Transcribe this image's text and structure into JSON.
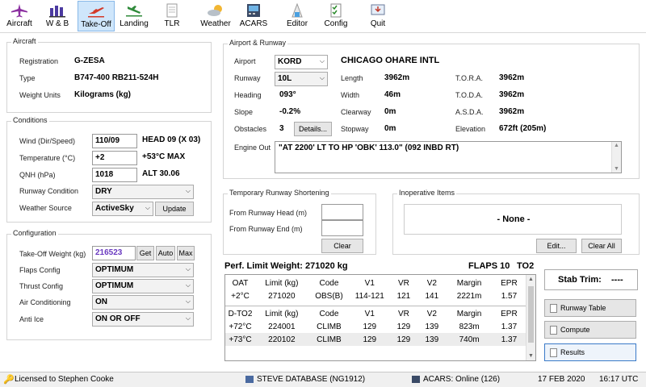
{
  "toolbar": {
    "items": [
      {
        "label": "Aircraft",
        "icon": "aircraft-icon"
      },
      {
        "label": "W & B",
        "icon": "weight-balance-icon"
      },
      {
        "label": "Take-Off",
        "icon": "takeoff-icon"
      },
      {
        "label": "Landing",
        "icon": "landing-icon"
      },
      {
        "label": "TLR",
        "icon": "tlr-document-icon"
      },
      {
        "label": "Weather",
        "icon": "weather-icon"
      },
      {
        "label": "ACARS",
        "icon": "acars-icon"
      },
      {
        "label": "Editor",
        "icon": "editor-icon"
      },
      {
        "label": "Config",
        "icon": "config-icon"
      },
      {
        "label": "Quit",
        "icon": "quit-icon"
      }
    ],
    "active": "Take-Off"
  },
  "aircraft": {
    "title": "Aircraft",
    "registration_label": "Registration",
    "registration": "G-ZESA",
    "type_label": "Type",
    "type": "B747-400 RB211-524H",
    "weight_units_label": "Weight Units",
    "weight_units": "Kilograms (kg)"
  },
  "conditions": {
    "title": "Conditions",
    "wind_label": "Wind (Dir/Speed)",
    "wind": "110/09",
    "wind_info": "HEAD 09 (X 03)",
    "temp_label": "Temperature (°C)",
    "temp": "+2",
    "temp_info": "+53°C MAX",
    "qnh_label": "QNH (hPa)",
    "qnh": "1018",
    "qnh_info": "ALT 30.06",
    "rwy_cond_label": "Runway Condition",
    "rwy_cond": "DRY",
    "wx_source_label": "Weather Source",
    "wx_source": "ActiveSky",
    "update_button": "Update"
  },
  "configuration": {
    "title": "Configuration",
    "tow_label": "Take-Off Weight (kg)",
    "tow": "216523",
    "get_button": "Get",
    "auto_button": "Auto",
    "max_button": "Max",
    "flaps_label": "Flaps Config",
    "flaps": "OPTIMUM",
    "thrust_label": "Thrust Config",
    "thrust": "OPTIMUM",
    "aircon_label": "Air Conditioning",
    "aircon": "ON",
    "antiice_label": "Anti Ice",
    "antiice": "ON OR OFF"
  },
  "airport": {
    "title": "Airport & Runway",
    "airport_label": "Airport",
    "airport": "KORD",
    "airport_name": "CHICAGO OHARE INTL",
    "runway_label": "Runway",
    "runway": "10L",
    "heading_label": "Heading",
    "heading": "093°",
    "slope_label": "Slope",
    "slope": "-0.2%",
    "obstacles_label": "Obstacles",
    "obstacles": "3",
    "details_button": "Details...",
    "length_label": "Length",
    "length": "3962m",
    "width_label": "Width",
    "width": "46m",
    "clearway_label": "Clearway",
    "clearway": "0m",
    "stopway_label": "Stopway",
    "stopway": "0m",
    "tora_label": "T.O.R.A.",
    "tora": "3962m",
    "toda_label": "T.O.D.A.",
    "toda": "3962m",
    "asda_label": "A.S.D.A.",
    "asda": "3962m",
    "elevation_label": "Elevation",
    "elevation": "672ft (205m)",
    "engine_out_label": "Engine Out",
    "engine_out": "\"AT 2200' LT TO HP 'OBK' 113.0\" (092 INBD RT)"
  },
  "shortening": {
    "title": "Temporary Runway Shortening",
    "from_head_label": "From Runway Head (m)",
    "from_end_label": "From Runway End (m)",
    "clear_button": "Clear"
  },
  "inoperative": {
    "title": "Inoperative Items",
    "none": "- None -",
    "edit_button": "Edit...",
    "clear_all_button": "Clear All"
  },
  "results": {
    "perf_limit": "Perf. Limit Weight: 271020 kg",
    "flaps": "FLAPS 10",
    "to_mode": "TO2",
    "headers": [
      "OAT",
      "Limit (kg)",
      "Code",
      "V1",
      "VR",
      "V2",
      "Margin",
      "EPR"
    ],
    "rows": [
      [
        "+2°C",
        "271020",
        "OBS(B)",
        "114-121",
        "121",
        "141",
        "2221m",
        "1.57"
      ]
    ],
    "dto_headers": [
      "D-TO2",
      "Limit (kg)",
      "Code",
      "V1",
      "VR",
      "V2",
      "Margin",
      "EPR"
    ],
    "dto_rows": [
      [
        "+72°C",
        "224001",
        "CLIMB",
        "129",
        "129",
        "139",
        "823m",
        "1.37"
      ],
      [
        "+73°C",
        "220102",
        "CLIMB",
        "129",
        "129",
        "139",
        "740m",
        "1.37"
      ]
    ]
  },
  "side": {
    "stab_trim_label": "Stab Trim:",
    "stab_trim": "----",
    "runway_table_button": "Runway Table",
    "compute_button": "Compute",
    "results_button": "Results"
  },
  "status": {
    "license": "Licensed to Stephen Cooke",
    "database": "STEVE DATABASE (NG1912)",
    "acars": "ACARS: Online (126)",
    "date": "17 FEB 2020",
    "time": "16:17 UTC"
  }
}
